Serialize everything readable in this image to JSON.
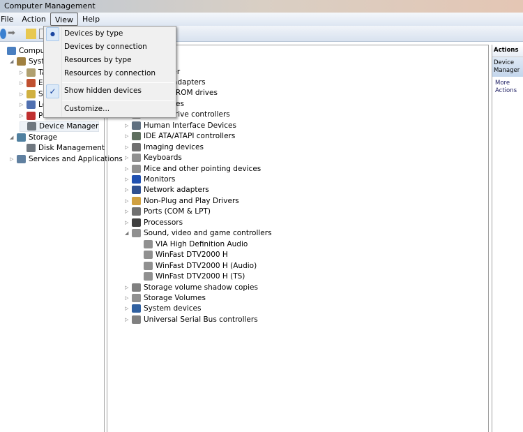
{
  "window": {
    "title": "Computer Management"
  },
  "menubar": [
    "File",
    "Action",
    "View",
    "Help"
  ],
  "left_tree": [
    {
      "label": "Computer Management (Local)",
      "indent": 0,
      "color": "#4a7fc0",
      "arrow": ""
    },
    {
      "label": "System Tools",
      "indent": 1,
      "color": "#a08040",
      "arrow": "◢"
    },
    {
      "label": "Task Scheduler",
      "indent": 2,
      "color": "#b0a070",
      "arrow": "▷"
    },
    {
      "label": "Event Viewer",
      "indent": 2,
      "color": "#c05030",
      "arrow": "▷"
    },
    {
      "label": "Shared Folders",
      "indent": 2,
      "color": "#d0b040",
      "arrow": "▷"
    },
    {
      "label": "Local Users and Groups",
      "indent": 2,
      "color": "#5070b0",
      "arrow": "▷"
    },
    {
      "label": "Performance",
      "indent": 2,
      "color": "#c03030",
      "arrow": "▷"
    },
    {
      "label": "Device Manager",
      "indent": 2,
      "color": "#707880",
      "arrow": "",
      "selected": true
    },
    {
      "label": "Storage",
      "indent": 1,
      "color": "#5080a0",
      "arrow": "◢"
    },
    {
      "label": "Disk Management",
      "indent": 2,
      "color": "#707880",
      "arrow": ""
    },
    {
      "label": "Services and Applications",
      "indent": 1,
      "color": "#6080a0",
      "arrow": "▷"
    }
  ],
  "device_tree": [
    {
      "label": "Computer",
      "indent": 1,
      "arrow": "▷"
    },
    {
      "label": "Display adapters",
      "indent": 1,
      "arrow": "▷"
    },
    {
      "label": "DVD/CD-ROM drives",
      "indent": 1,
      "arrow": "▷"
    },
    {
      "label": "Disk drives",
      "indent": 1,
      "arrow": "▷"
    },
    {
      "label": "Floppy drive controllers",
      "indent": 1,
      "arrow": "▷"
    },
    {
      "label": "Human Interface Devices",
      "indent": 1,
      "arrow": "▷"
    },
    {
      "label": "IDE ATA/ATAPI controllers",
      "indent": 1,
      "arrow": "▷"
    },
    {
      "label": "Imaging devices",
      "indent": 1,
      "arrow": "▷"
    },
    {
      "label": "Keyboards",
      "indent": 1,
      "arrow": "▷"
    },
    {
      "label": "Mice and other pointing devices",
      "indent": 1,
      "arrow": "▷"
    },
    {
      "label": "Monitors",
      "indent": 1,
      "arrow": "▷"
    },
    {
      "label": "Network adapters",
      "indent": 1,
      "arrow": "▷"
    },
    {
      "label": "Non-Plug and Play Drivers",
      "indent": 1,
      "arrow": "▷"
    },
    {
      "label": "Ports (COM & LPT)",
      "indent": 1,
      "arrow": "▷"
    },
    {
      "label": "Processors",
      "indent": 1,
      "arrow": "▷"
    },
    {
      "label": "Sound, video and game controllers",
      "indent": 1,
      "arrow": "◢"
    },
    {
      "label": "VIA High Definition Audio",
      "indent": 2,
      "arrow": ""
    },
    {
      "label": "WinFast DTV2000 H",
      "indent": 2,
      "arrow": ""
    },
    {
      "label": "WinFast DTV2000 H (Audio)",
      "indent": 2,
      "arrow": ""
    },
    {
      "label": "WinFast DTV2000 H (TS)",
      "indent": 2,
      "arrow": ""
    },
    {
      "label": "Storage volume shadow copies",
      "indent": 1,
      "arrow": "▷"
    },
    {
      "label": "Storage Volumes",
      "indent": 1,
      "arrow": "▷"
    },
    {
      "label": "System devices",
      "indent": 1,
      "arrow": "▷"
    },
    {
      "label": "Universal Serial Bus controllers",
      "indent": 1,
      "arrow": "▷"
    }
  ],
  "actions": {
    "header": "Actions",
    "section": "Device Manager",
    "more": "More Actions"
  },
  "view_menu": {
    "items": [
      {
        "label": "Devices by type",
        "mark": "radio"
      },
      {
        "label": "Devices by connection",
        "mark": ""
      },
      {
        "label": "Resources by type",
        "mark": ""
      },
      {
        "label": "Resources by connection",
        "mark": ""
      },
      {
        "label": "Show hidden devices",
        "mark": "check"
      },
      {
        "label": "Customize...",
        "mark": ""
      }
    ]
  }
}
